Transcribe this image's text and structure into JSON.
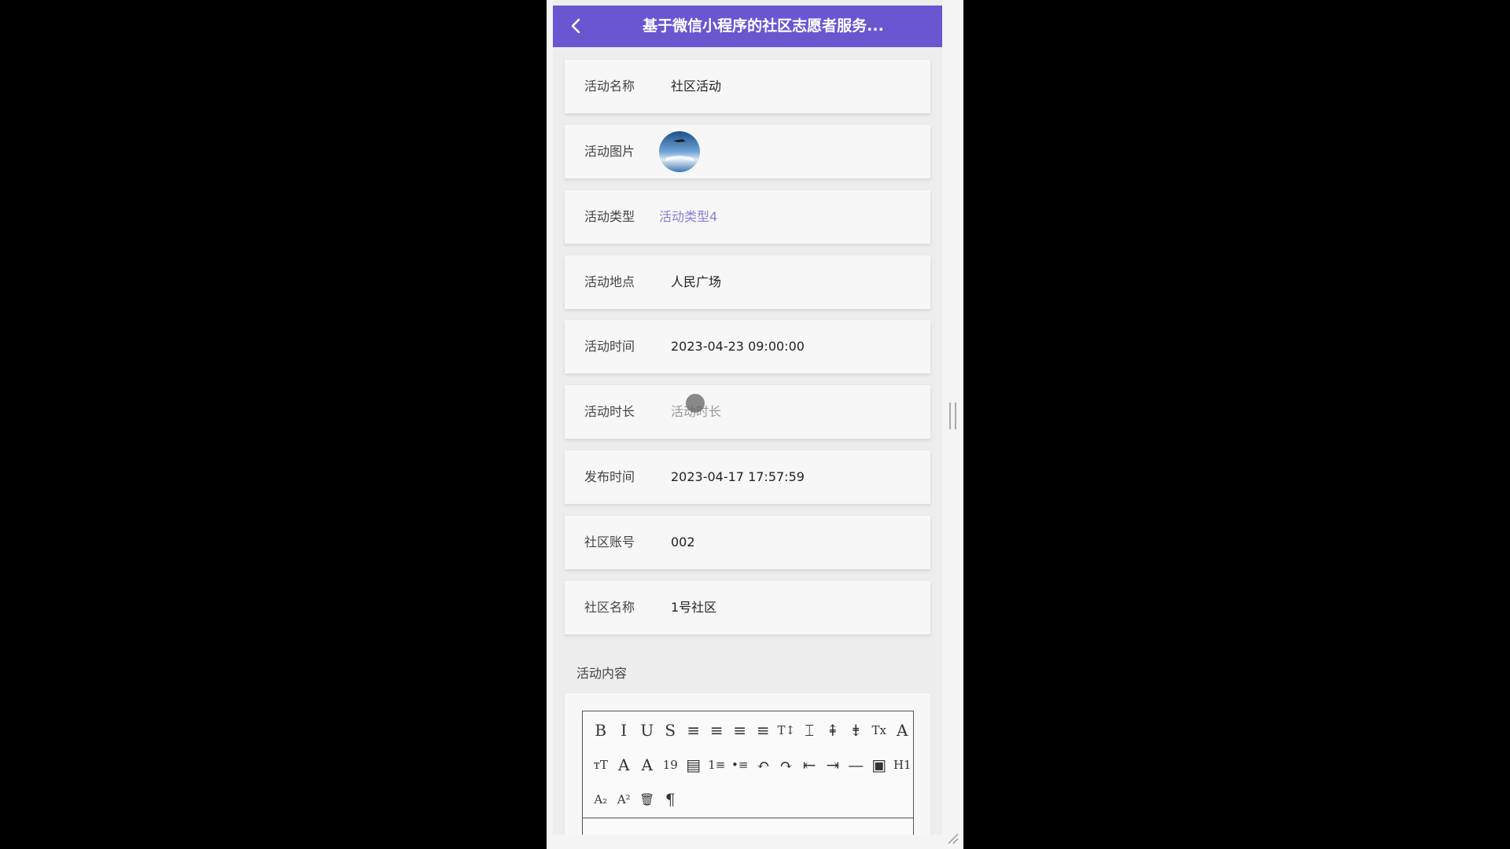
{
  "nav": {
    "title": "基于微信小程序的社区志愿者服务...",
    "back_icon": "chevron-left-icon",
    "color": "#6a56cf"
  },
  "fields": [
    {
      "label": "活动名称",
      "value": "社区活动"
    },
    {
      "label": "活动图片",
      "value": ""
    },
    {
      "label": "活动类型",
      "value": "活动类型4"
    },
    {
      "label": "活动地点",
      "value": "人民广场"
    },
    {
      "label": "活动时间",
      "value": "2023-04-23 09:00:00"
    },
    {
      "label": "活动时长",
      "value": "活动时长"
    },
    {
      "label": "发布时间",
      "value": "2023-04-17 17:57:59"
    },
    {
      "label": "社区账号",
      "value": "002"
    },
    {
      "label": "社区名称",
      "value": "1号社区"
    }
  ],
  "content": {
    "label": "活动内容"
  },
  "toolbar": {
    "row1": [
      "B",
      "I",
      "U",
      "S",
      "≡",
      "≡",
      "≡",
      "≡",
      "T↕",
      "⌶",
      "⇞",
      "⇟",
      "Tx",
      "A"
    ],
    "row2": [
      "тT",
      "A",
      "A",
      "19",
      "▤",
      "1≡",
      "•≡",
      "↶",
      "↷",
      "⇤",
      "⇥",
      "—",
      "▣",
      "H1"
    ],
    "row3": [
      "A₂",
      "A²",
      "🗑",
      "¶"
    ],
    "icons_row1": [
      "bold-icon",
      "italic-icon",
      "underline-icon",
      "strikethrough-icon",
      "align-left-icon",
      "align-center-icon",
      "align-right-icon",
      "justify-icon",
      "line-height-icon",
      "letter-spacing-icon",
      "space-before-icon",
      "space-after-icon",
      "clear-format-icon",
      "font-icon"
    ],
    "icons_row2": [
      "font-size-icon",
      "text-color-icon",
      "bg-color-icon",
      "date-icon",
      "clipboard-icon",
      "ordered-list-icon",
      "unordered-list-icon",
      "undo-icon",
      "redo-icon",
      "outdent-icon",
      "indent-icon",
      "divider-icon",
      "image-icon",
      "heading-icon"
    ],
    "icons_row3": [
      "subscript-icon",
      "superscript-icon",
      "delete-icon",
      "paragraph-icon"
    ]
  }
}
